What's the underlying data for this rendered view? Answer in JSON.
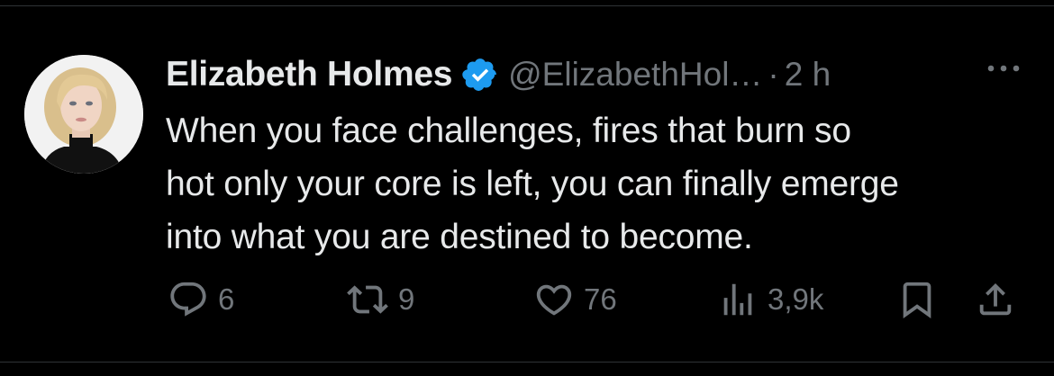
{
  "tweet": {
    "author": {
      "display_name": "Elizabeth Holmes",
      "handle": "@ElizabethHol…",
      "verified": true,
      "avatar_icon": "profile-photo-avatar"
    },
    "separator": "·",
    "timestamp": "2 h",
    "text_lines": [
      "When you face challenges, fires that burn so",
      "hot only your core is left, you can finally emerge",
      "into what you are destined to become."
    ],
    "actions": {
      "reply_count": "6",
      "retweet_count": "9",
      "like_count": "76",
      "views_count": "3,9k"
    }
  },
  "colors": {
    "background": "#000000",
    "text_primary": "#e7e9ea",
    "text_secondary": "#71767b",
    "verified_badge": "#1d9bf0",
    "divider": "#2f3336"
  },
  "icons": [
    "verified-badge-icon",
    "more-options-icon",
    "reply-icon",
    "retweet-icon",
    "like-icon",
    "views-icon",
    "bookmark-icon",
    "share-icon"
  ]
}
